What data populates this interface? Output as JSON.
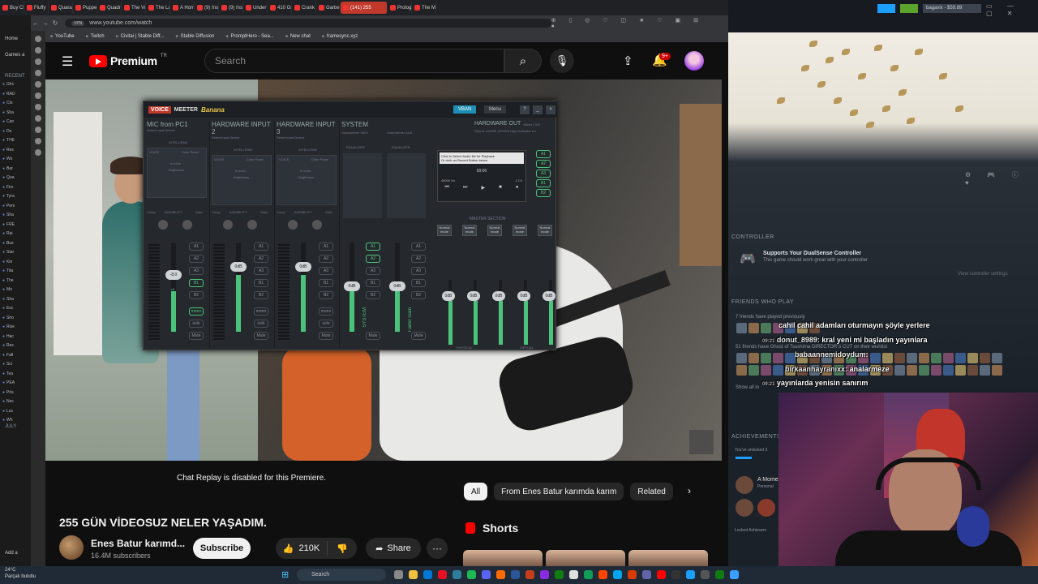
{
  "browser": {
    "tabs": [
      "Buy Ch",
      "Fluffy",
      "Quara",
      "Puppe",
      "Quadr",
      "The Vo",
      "The La",
      "A Horr",
      "(9) Insi",
      "(9) Insi",
      "Under",
      "410 Gr",
      "Crank",
      "Garbe",
      "(141) 255",
      "Prolog",
      "The M"
    ],
    "active_tab": "(141) 255",
    "url": "www.youtube.com/watch",
    "site_badge": "VPN",
    "bookmarks": [
      "YouTube",
      "Twitch",
      "Civitai | Stable Diff...",
      "Stable Diffusion",
      "PromptHero - Sea...",
      "New chat",
      "framesync.xyz"
    ]
  },
  "left_sidebar": {
    "home": "Home",
    "games": "Games a",
    "recent": "RECENT",
    "july": "JULY",
    "add": "Add a",
    "items": [
      "Ghc",
      "RAD",
      "Clo",
      "Sha",
      "Can",
      "Do",
      "THE",
      "Res",
      "Wo",
      "Bar",
      "Qua",
      "Firs",
      "Tyra",
      "Pers",
      "Sha",
      "FRE",
      "Rai",
      "Bus",
      "Star",
      "Kin",
      "Tita",
      "The",
      "Mo",
      "Sha",
      "Esc",
      "Sho",
      "Rise",
      "Hac",
      "Res",
      "Fall",
      "Sci",
      "Tea",
      "PEA",
      "Pris",
      "Nec",
      "Luc",
      "Wh",
      "DIR",
      "Bog",
      "Ma",
      "Ene",
      "Fall"
    ]
  },
  "youtube": {
    "logo_text": "Premium",
    "region": "TR",
    "search_placeholder": "Search",
    "notification_count": "9+",
    "chat_replay": "Chat Replay is disabled for this Premiere.",
    "video_title": "255 GÜN VİDEOSUZ NELER YAŞADIM.",
    "channel_name": "Enes Batur karımd...",
    "channel_subs": "16.4M subscribers",
    "subscribe": "Subscribe",
    "likes": "210K",
    "share": "Share",
    "more": "···",
    "chips": [
      "All",
      "From Enes Batur karımda karım",
      "Related"
    ],
    "shorts_title": "Shorts"
  },
  "voicemeeter": {
    "brand_voice": "VOICE",
    "brand_meeter": "MEETER",
    "brand_banana": "Banana",
    "vban": "VBAN",
    "menu": "Menu",
    "strips": [
      {
        "title": "MIC from PC1",
        "sub": "Select Input Device",
        "fader_label": "MIC from PC1",
        "db": "-8.0"
      },
      {
        "title": "HARDWARE INPUT 2",
        "sub": "Select Input Device",
        "fader_label": "Fader Gain",
        "db": "0dB"
      },
      {
        "title": "HARDWARE INPUT 3",
        "sub": "Select Input Device",
        "fader_label": "Fader Gain",
        "db": "0dB"
      }
    ],
    "virtual_title": "SYSTEM",
    "virtual_sub": "Voicemeeter VAIO",
    "aux_sub": "Voicemeeter AUX",
    "intellipan": "INTELLIPAN",
    "equalizer": "EQUALIZER",
    "audibility": "AUDIBILITY",
    "comp": "Comp.",
    "gate": "Gate",
    "voice_label": "VOICE",
    "color_panel": "Color Panel",
    "fx_echo": "fx echo",
    "brightness": "Brightness",
    "mono": "mono",
    "solo": "solo",
    "mute": "Mute",
    "virtual_fader": "SYSTEM",
    "aux_fader": "Fader Gain",
    "hardware_out": "HARDWARE OUT",
    "hardware_out_sub": "48kHz | 512",
    "hardware_out_device": "Sbpro1-44HDR (NVIDIA High Definition Au",
    "recorder_msg": "Click to Select Audio file for Playback",
    "recorder_msg2": "Or click on Record Button below",
    "recorder_time": "00:00",
    "recorder_hz": "48000 Hz",
    "recorder_ch": "2 Ch",
    "master_section": "MASTER SECTION",
    "normal_mode": "Normal mode",
    "physical": "PHYSICAL",
    "virtual": "VIRTUAL",
    "bus_buttons": [
      "A1",
      "A2",
      "A3",
      "B1",
      "B2"
    ]
  },
  "steam": {
    "controller_section": "CONTROLLER",
    "controller_title": "Supports Your DualSense Controller",
    "controller_sub": "This game should work great with your controller",
    "controller_link": "View controller settings",
    "friends_section": "FRIENDS WHO PLAY",
    "friends_line1": "7 friends have played previously",
    "friends_line2": "51 friends have Ghost of Tsushima DIRECTOR'S CUT on their wishlist",
    "show_all": "Show all in",
    "achievements_section": "ACHIEVEMENTS",
    "ach_unlocked": "You've unlocked 3",
    "ach_item": "A Mome",
    "ach_sub": "Personal",
    "locked": "Locked Achievem",
    "user": "bagavix",
    "wallet": "$59.89"
  },
  "chat": [
    {
      "time": "",
      "user": "",
      "msg": "cahil cahil adamları oturmayın şöyle yerlere"
    },
    {
      "time": "09:21",
      "user": "donut_8989:",
      "msg": "kral yeni mi başladın yayınlara"
    },
    {
      "time": "",
      "user": "babaannemidoydum:",
      "msg": ""
    },
    {
      "time": "",
      "user": "birkaanhayranıxx:",
      "msg": "analarmeze"
    },
    {
      "time": "09:21",
      "user": "",
      "msg": "yayınlarda yenisin sanırım"
    }
  ],
  "taskbar": {
    "weather_temp": "24°C",
    "weather_desc": "Parçalı bulutlu",
    "search": "Search"
  },
  "colors": {
    "yt_red": "#ff0000",
    "vm_green": "#4cc37a",
    "steam_bg": "#1b2129"
  }
}
